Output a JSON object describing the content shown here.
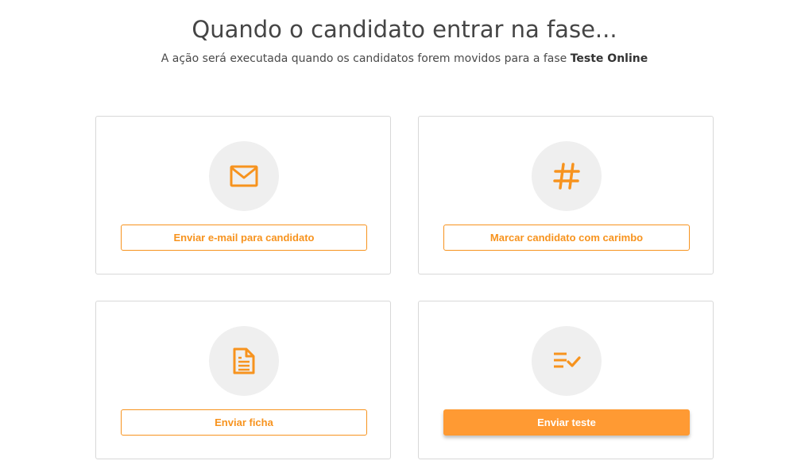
{
  "header": {
    "title": "Quando o candidato entrar na fase...",
    "subtitle_prefix": "A ação será executada quando os candidatos forem movidos para a fase ",
    "phase_name": "Teste Online"
  },
  "colors": {
    "accent": "#f7931e",
    "primary_button": "#ff9a33",
    "icon_circle": "#efefef"
  },
  "actions": [
    {
      "icon": "envelope-icon",
      "label": "Enviar e-mail para candidato"
    },
    {
      "icon": "hashtag-icon",
      "label": "Marcar candidato com carimbo"
    },
    {
      "icon": "document-icon",
      "label": "Enviar ficha"
    },
    {
      "icon": "checklist-icon",
      "label": "Enviar teste"
    }
  ]
}
